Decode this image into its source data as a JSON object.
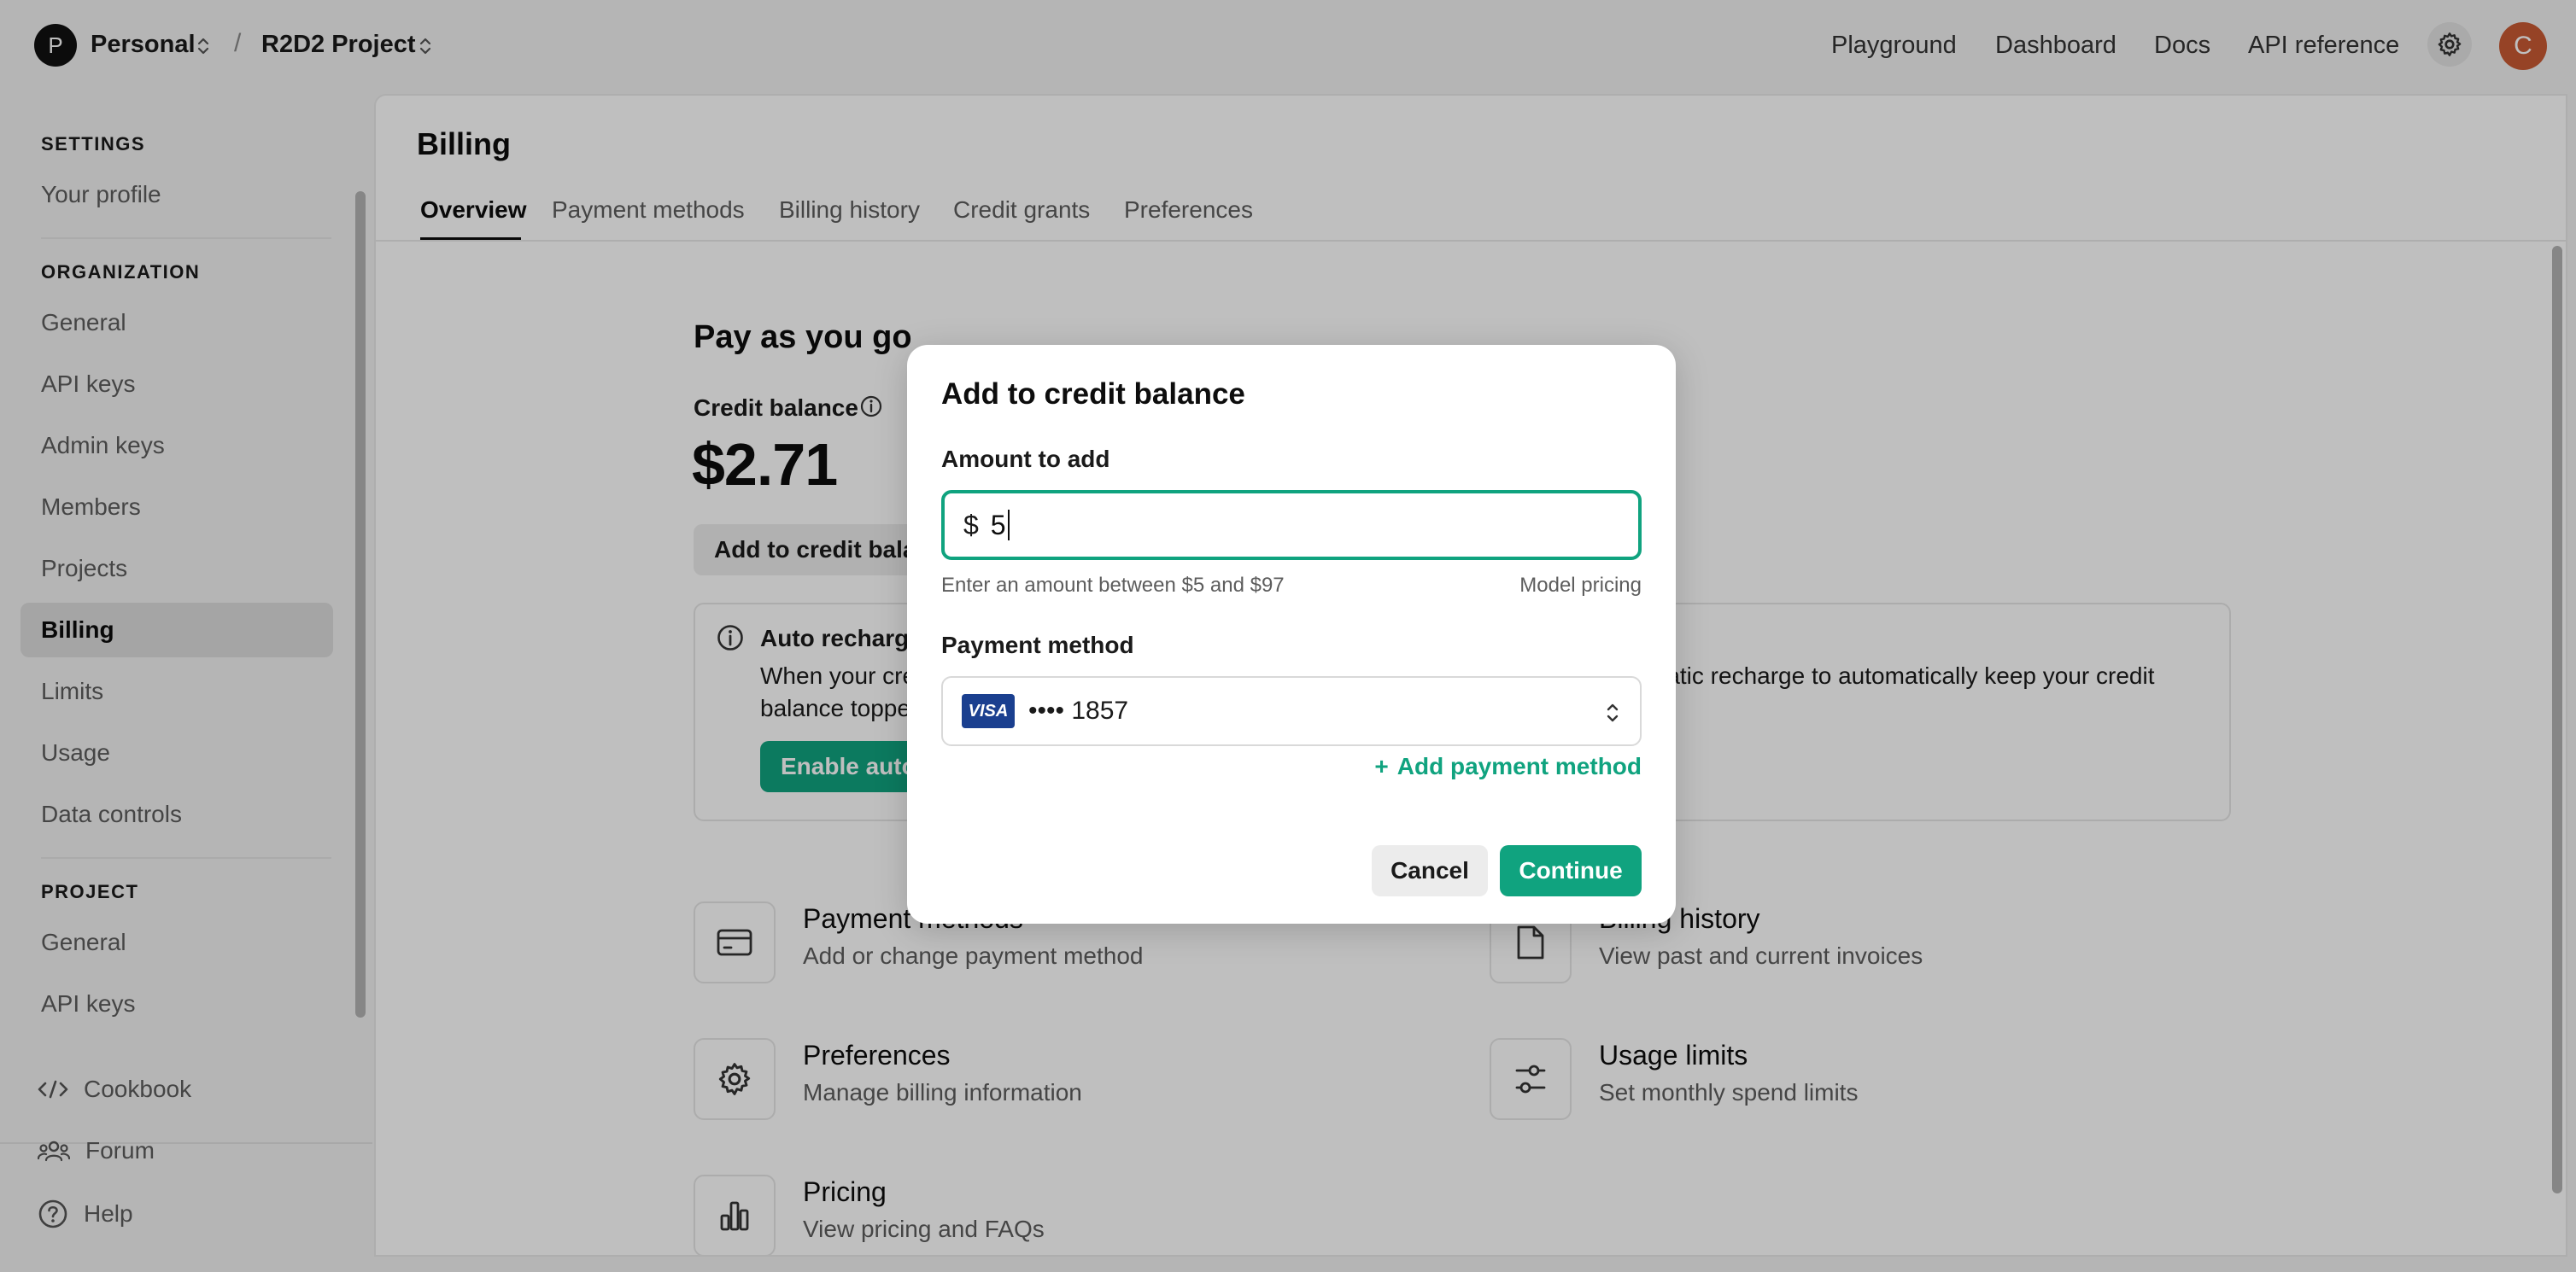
{
  "topbar": {
    "org_initial": "P",
    "org_name": "Personal",
    "separator": "/",
    "project_name": "R2D2 Project",
    "nav": [
      "Playground",
      "Dashboard",
      "Docs",
      "API reference"
    ],
    "user_initial": "C"
  },
  "sidebar": {
    "settings_heading": "SETTINGS",
    "settings_items": [
      "Your profile"
    ],
    "organization_heading": "ORGANIZATION",
    "organization_items": [
      "General",
      "API keys",
      "Admin keys",
      "Members",
      "Projects",
      "Billing",
      "Limits",
      "Usage",
      "Data controls"
    ],
    "active_item": "Billing",
    "project_heading": "PROJECT",
    "project_items": [
      "General",
      "API keys"
    ],
    "footer_items": [
      "Cookbook",
      "Forum",
      "Help"
    ]
  },
  "main": {
    "title": "Billing",
    "tabs": [
      "Overview",
      "Payment methods",
      "Billing history",
      "Credit grants",
      "Preferences"
    ],
    "active_tab": "Overview",
    "section_title": "Pay as you go",
    "credit_balance_label": "Credit balance",
    "credit_balance_value": "$2.71",
    "add_credit_button": "Add to credit bala",
    "auto_recharge": {
      "title": "Auto recharge",
      "desc_line1": "When your cre",
      "desc_line2": "balance toppe",
      "desc_right": "matic recharge to automatically keep your credit",
      "button": "Enable auto"
    },
    "cards": [
      {
        "title": "Payment methods",
        "desc": "Add or change payment method",
        "icon": "credit-card-icon"
      },
      {
        "title": "Billing history",
        "desc": "View past and current invoices",
        "icon": "document-icon"
      },
      {
        "title": "Preferences",
        "desc": "Manage billing information",
        "icon": "gear-icon"
      },
      {
        "title": "Usage limits",
        "desc": "Set monthly spend limits",
        "icon": "sliders-icon"
      },
      {
        "title": "Pricing",
        "desc": "View pricing and FAQs",
        "icon": "bar-chart-icon"
      }
    ]
  },
  "modal": {
    "title": "Add to credit balance",
    "amount_label": "Amount to add",
    "currency_symbol": "$",
    "amount_value": "5",
    "hint": "Enter an amount between $5 and $97",
    "model_pricing_link": "Model pricing",
    "payment_method_label": "Payment method",
    "card_brand": "VISA",
    "card_masked": "•••• 1857",
    "add_payment_method": "Add payment method",
    "add_payment_method_prefix": "+",
    "cancel": "Cancel",
    "continue": "Continue"
  },
  "colors": {
    "accent": "#10a37f",
    "user_avatar": "#c85a33",
    "visa": "#1a3f8f"
  }
}
